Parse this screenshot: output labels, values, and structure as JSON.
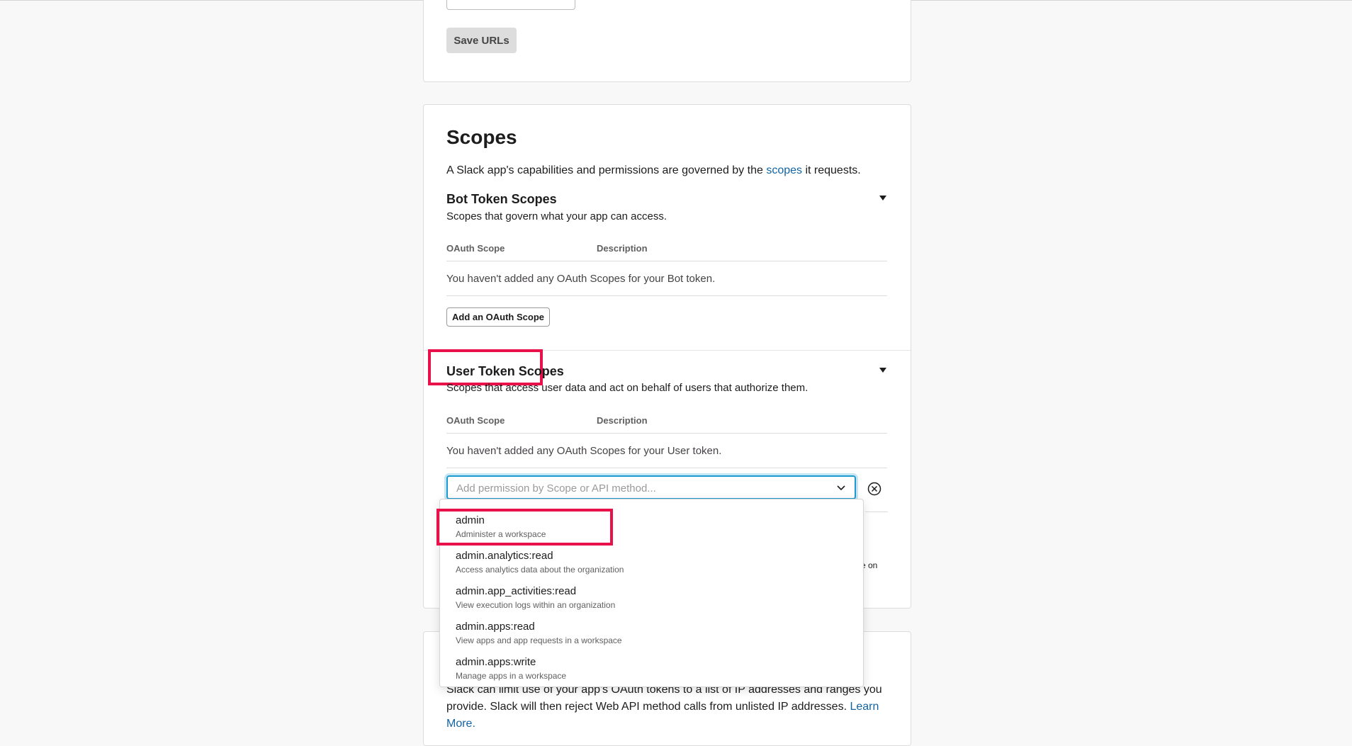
{
  "urls_card": {
    "save_label": "Save URLs"
  },
  "scopes": {
    "title": "Scopes",
    "intro_before": "A Slack app's capabilities and permissions are governed by the ",
    "intro_link": "scopes",
    "intro_after": " it requests.",
    "bot": {
      "title": "Bot Token Scopes",
      "subtitle": "Scopes that govern what your app can access.",
      "col_scope": "OAuth Scope",
      "col_desc": "Description",
      "empty": "You haven't added any OAuth Scopes for your Bot token.",
      "add_label": "Add an OAuth Scope"
    },
    "user": {
      "title": "User Token Scopes",
      "subtitle": "Scopes that access user data and act on behalf of users that authorize them.",
      "col_scope": "OAuth Scope",
      "col_desc": "Description",
      "empty": "You haven't added any OAuth Scopes for your User token.",
      "search_placeholder": "Add permission by Scope or API method...",
      "trailing": "e on"
    }
  },
  "ip_card": {
    "text": "Slack can limit use of your app's OAuth tokens to a list of IP addresses and ranges you provide. Slack will then reject Web API method calls from unlisted IP addresses. ",
    "link": "Learn More."
  },
  "dropdown": {
    "options": [
      {
        "name": "admin",
        "desc": "Administer a workspace"
      },
      {
        "name": "admin.analytics:read",
        "desc": "Access analytics data about the organization"
      },
      {
        "name": "admin.app_activities:read",
        "desc": "View execution logs within an organization"
      },
      {
        "name": "admin.apps:read",
        "desc": "View apps and app requests in a workspace"
      },
      {
        "name": "admin.apps:write",
        "desc": "Manage apps in a workspace"
      }
    ]
  },
  "colors": {
    "highlight": "#e8114a",
    "link": "#1264a3",
    "focus": "#1d9bd1"
  }
}
